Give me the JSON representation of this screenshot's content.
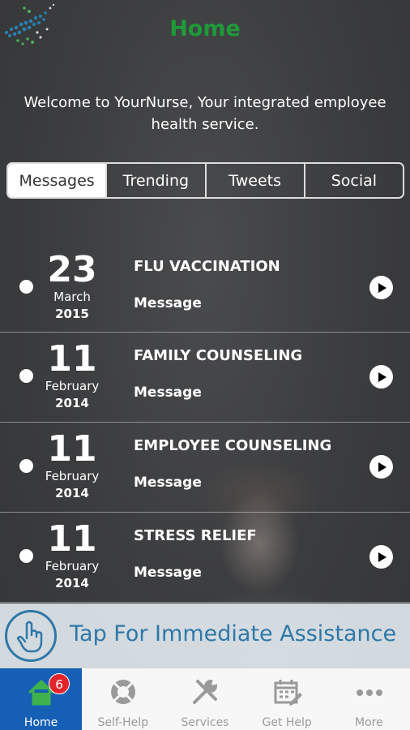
{
  "header": {
    "title": "Home",
    "welcome": "Welcome to YourNurse, Your integrated employee health service."
  },
  "tabs": [
    {
      "label": "Messages",
      "active": true
    },
    {
      "label": "Trending",
      "active": false
    },
    {
      "label": "Tweets",
      "active": false
    },
    {
      "label": "Social",
      "active": false
    }
  ],
  "messages": [
    {
      "day": "23",
      "month": "March",
      "year": "2015",
      "title": "FLU VACCINATION",
      "type": "Message"
    },
    {
      "day": "11",
      "month": "February",
      "year": "2014",
      "title": "FAMILY COUNSELING",
      "type": "Message"
    },
    {
      "day": "11",
      "month": "February",
      "year": "2014",
      "title": "EMPLOYEE COUNSELING",
      "type": "Message"
    },
    {
      "day": "11",
      "month": "February",
      "year": "2014",
      "title": "STRESS RELIEF",
      "type": "Message"
    }
  ],
  "assist": {
    "label": "Tap For Immediate Assistance",
    "icon": "hand-pointer-icon"
  },
  "tabbar": [
    {
      "label": "Home",
      "icon": "home-icon",
      "badge": "6",
      "active": true
    },
    {
      "label": "Self-Help",
      "icon": "lifebuoy-icon",
      "active": false
    },
    {
      "label": "Services",
      "icon": "tools-icon",
      "active": false
    },
    {
      "label": "Get Help",
      "icon": "calendar-icon",
      "active": false
    },
    {
      "label": "More",
      "icon": "more-dots-icon",
      "active": false
    }
  ],
  "colors": {
    "title": "#1f9a3a",
    "accent": "#1560b4",
    "assist_text": "#2f78a8",
    "badge": "#e3242b"
  }
}
